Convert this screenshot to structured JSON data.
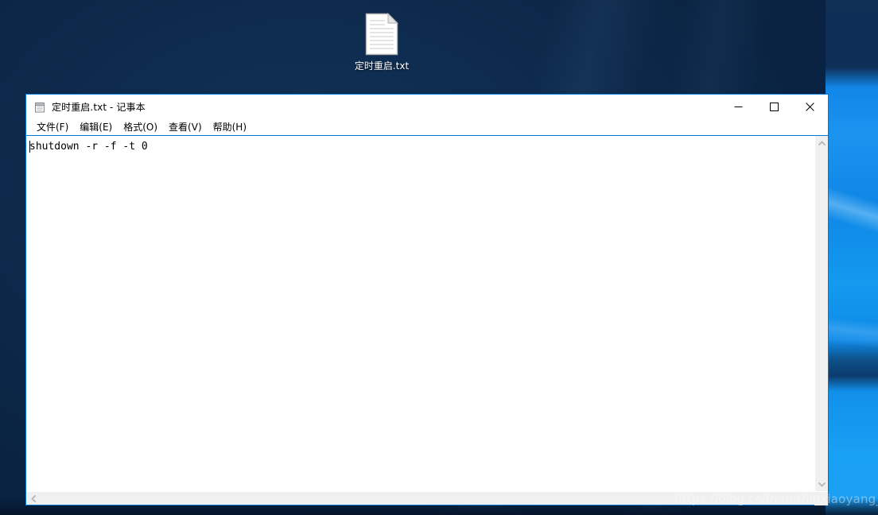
{
  "desktop": {
    "icon": {
      "label": "定时重启.txt",
      "icon_name": "text-file-icon"
    },
    "watermark": "https://blog.csdn.net/liuxiaoyang_"
  },
  "window": {
    "app": "记事本",
    "title": "定时重启.txt - 记事本",
    "icon_name": "notepad-icon",
    "controls": {
      "minimize": "—",
      "maximize": "▢",
      "close": "✕",
      "minimize_name": "minimize-button",
      "maximize_name": "maximize-button",
      "close_name": "close-button"
    },
    "menu": [
      {
        "label": "文件(F)",
        "text": "文件",
        "mnemonic": "F"
      },
      {
        "label": "编辑(E)",
        "text": "编辑",
        "mnemonic": "E"
      },
      {
        "label": "格式(O)",
        "text": "格式",
        "mnemonic": "O"
      },
      {
        "label": "查看(V)",
        "text": "查看",
        "mnemonic": "V"
      },
      {
        "label": "帮助(H)",
        "text": "帮助",
        "mnemonic": "H"
      }
    ],
    "document": {
      "content": "shutdown -r -f -t 0",
      "caret_position": 0
    },
    "scrollbars": {
      "vertical_up": "▲",
      "vertical_down": "▼",
      "horizontal_left": "◄"
    }
  },
  "colors": {
    "accent": "#0078d7",
    "window_bg": "#ffffff",
    "scrollbar_track": "#f0f0f0",
    "desktop_dark": "#0a2342",
    "desktop_bright": "#1b94f0",
    "close_hover": "#e81123"
  }
}
